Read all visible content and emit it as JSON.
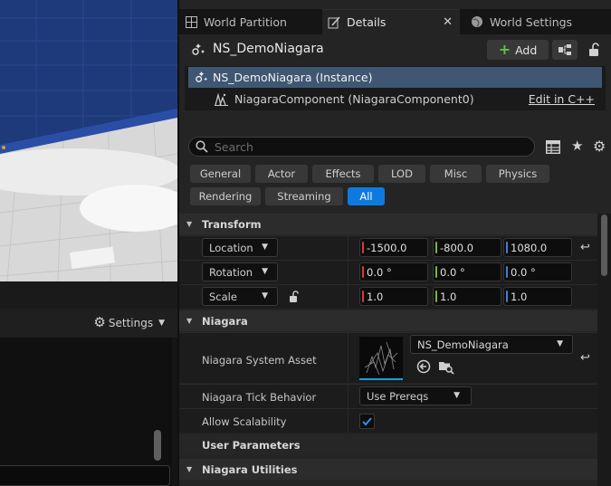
{
  "viewport": {
    "sky_color": "#1f3a7a",
    "floor_color": "#d8d8d8"
  },
  "left_panel": {
    "settings_label": "Settings"
  },
  "tabs": [
    {
      "label": "World Partition",
      "icon": "world-partition-icon"
    },
    {
      "label": "Details",
      "icon": "details-pencil-icon",
      "active": true
    },
    {
      "label": "World Settings",
      "icon": "globe-icon"
    }
  ],
  "tab_close_symbol": "✕",
  "actor": {
    "name": "NS_DemoNiagara",
    "add_label": "Add"
  },
  "components": [
    {
      "label": "NS_DemoNiagara (Instance)",
      "selected": true
    },
    {
      "label": "NiagaraComponent (NiagaraComponent0)",
      "action": "Edit in C++"
    }
  ],
  "search": {
    "placeholder": "Search",
    "value": ""
  },
  "categories": {
    "row1": [
      "General",
      "Actor",
      "Effects",
      "LOD",
      "Misc",
      "Physics"
    ],
    "row2": [
      "Rendering",
      "Streaming",
      "All"
    ],
    "active": "All"
  },
  "sections": {
    "transform": "Transform",
    "niagara": "Niagara",
    "user_parameters": "User Parameters",
    "niagara_utilities": "Niagara Utilities"
  },
  "transform": {
    "location": {
      "label": "Location",
      "x": "-1500.0",
      "y": "-800.0",
      "z": "1080.0"
    },
    "rotation": {
      "label": "Rotation",
      "x": "0.0 °",
      "y": "0.0 °",
      "z": "0.0 °"
    },
    "scale": {
      "label": "Scale",
      "x": "1.0",
      "y": "1.0",
      "z": "1.0"
    }
  },
  "niagara": {
    "system_asset_label": "Niagara System Asset",
    "system_asset_value": "NS_DemoNiagara",
    "tick_behavior_label": "Niagara Tick Behavior",
    "tick_behavior_value": "Use Prereqs",
    "allow_scalability_label": "Allow Scalability",
    "allow_scalability_checked": true
  },
  "colors": {
    "accent_blue": "#0e7ae0",
    "selection_blue": "#3f5773",
    "add_green": "#62c23c",
    "axis_x": "#d43b3b",
    "axis_y": "#7ab531",
    "axis_z": "#3f7fd6"
  }
}
